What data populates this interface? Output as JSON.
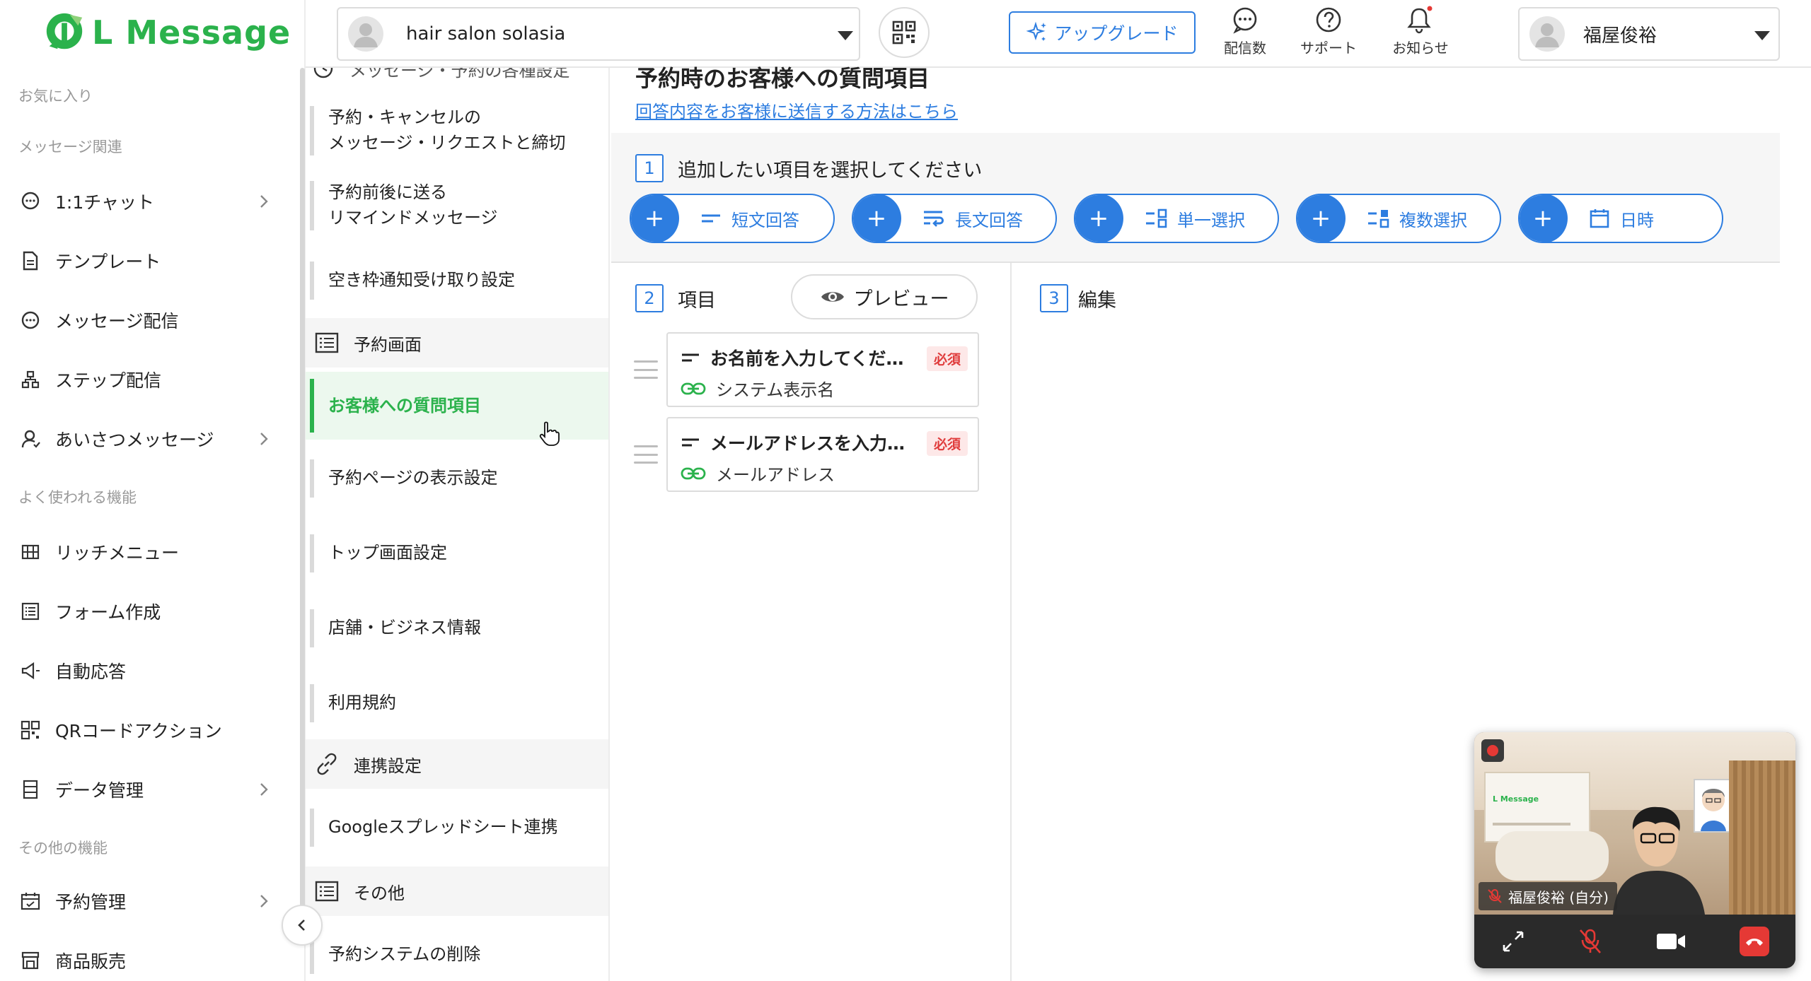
{
  "brand": {
    "name": "L Message",
    "color": "#2bb24c",
    "accent": "#2d7de0"
  },
  "header": {
    "account_name": "hair salon solasia",
    "upgrade_label": "アップグレード",
    "icons": [
      {
        "name": "delivery-count",
        "label": "配信数"
      },
      {
        "name": "support",
        "label": "サポート"
      },
      {
        "name": "notifications",
        "label": "お知らせ"
      }
    ],
    "user_name": "福屋俊裕"
  },
  "sidebar": {
    "sections": {
      "favorites": "お気に入り",
      "message": "メッセージ関連",
      "common": "よく使われる機能",
      "other": "その他の機能"
    },
    "items": [
      {
        "label": "1:1チャット",
        "icon": "chat-icon"
      },
      {
        "label": "テンプレート",
        "icon": "document-icon"
      },
      {
        "label": "メッセージ配信",
        "icon": "message-icon"
      },
      {
        "label": "ステップ配信",
        "icon": "step-icon"
      },
      {
        "label": "あいさつメッセージ",
        "icon": "user-icon"
      },
      {
        "label": "リッチメニュー",
        "icon": "grid-icon"
      },
      {
        "label": "フォーム作成",
        "icon": "form-icon"
      },
      {
        "label": "自動応答",
        "icon": "megaphone-icon"
      },
      {
        "label": "QRコードアクション",
        "icon": "qr-icon"
      },
      {
        "label": "データ管理",
        "icon": "database-icon"
      },
      {
        "label": "予約管理",
        "icon": "calendar-icon"
      },
      {
        "label": "商品販売",
        "icon": "store-icon"
      }
    ]
  },
  "subnav": {
    "top_partial": "メッセージ・予約の各種設定",
    "items": {
      "cancel_line1": "予約・キャンセルの",
      "cancel_line2": "メッセージ・リクエストと締切",
      "remind_line1": "予約前後に送る",
      "remind_line2": "リマインドメッセージ",
      "vacancy": "空き枠通知受け取り設定",
      "booking_screen": "予約画面",
      "questions": "お客様への質問項目",
      "page_display": "予約ページの表示設定",
      "top_screen": "トップ画面設定",
      "store_info": "店舗・ビジネス情報",
      "terms": "利用規約",
      "integrations": "連携設定",
      "sheets": "Googleスプレッドシート連携",
      "other": "その他",
      "delete_system": "予約システムの削除"
    }
  },
  "main": {
    "title": "予約時のお客様への質問項目",
    "link": "回答内容をお客様に送信する方法はこちら",
    "step1": {
      "num": "1",
      "label": "追加したい項目を選択してください"
    },
    "add_buttons": [
      {
        "label": "短文回答",
        "icon": "short-text-icon"
      },
      {
        "label": "長文回答",
        "icon": "long-text-icon"
      },
      {
        "label": "単一選択",
        "icon": "single-select-icon"
      },
      {
        "label": "複数選択",
        "icon": "multi-select-icon"
      },
      {
        "label": "日時",
        "icon": "calendar-icon"
      }
    ],
    "step2": {
      "num": "2",
      "label": "項目"
    },
    "preview_label": "プレビュー",
    "step3": {
      "num": "3",
      "label": "編集"
    },
    "required_label": "必須",
    "items": [
      {
        "title": "お名前を入力してくだ…",
        "sub": "システム表示名"
      },
      {
        "title": "メールアドレスを入力…",
        "sub": "メールアドレス"
      }
    ]
  },
  "video": {
    "name_tag": "福屋俊裕 (自分)",
    "poster_text": "L Message"
  }
}
